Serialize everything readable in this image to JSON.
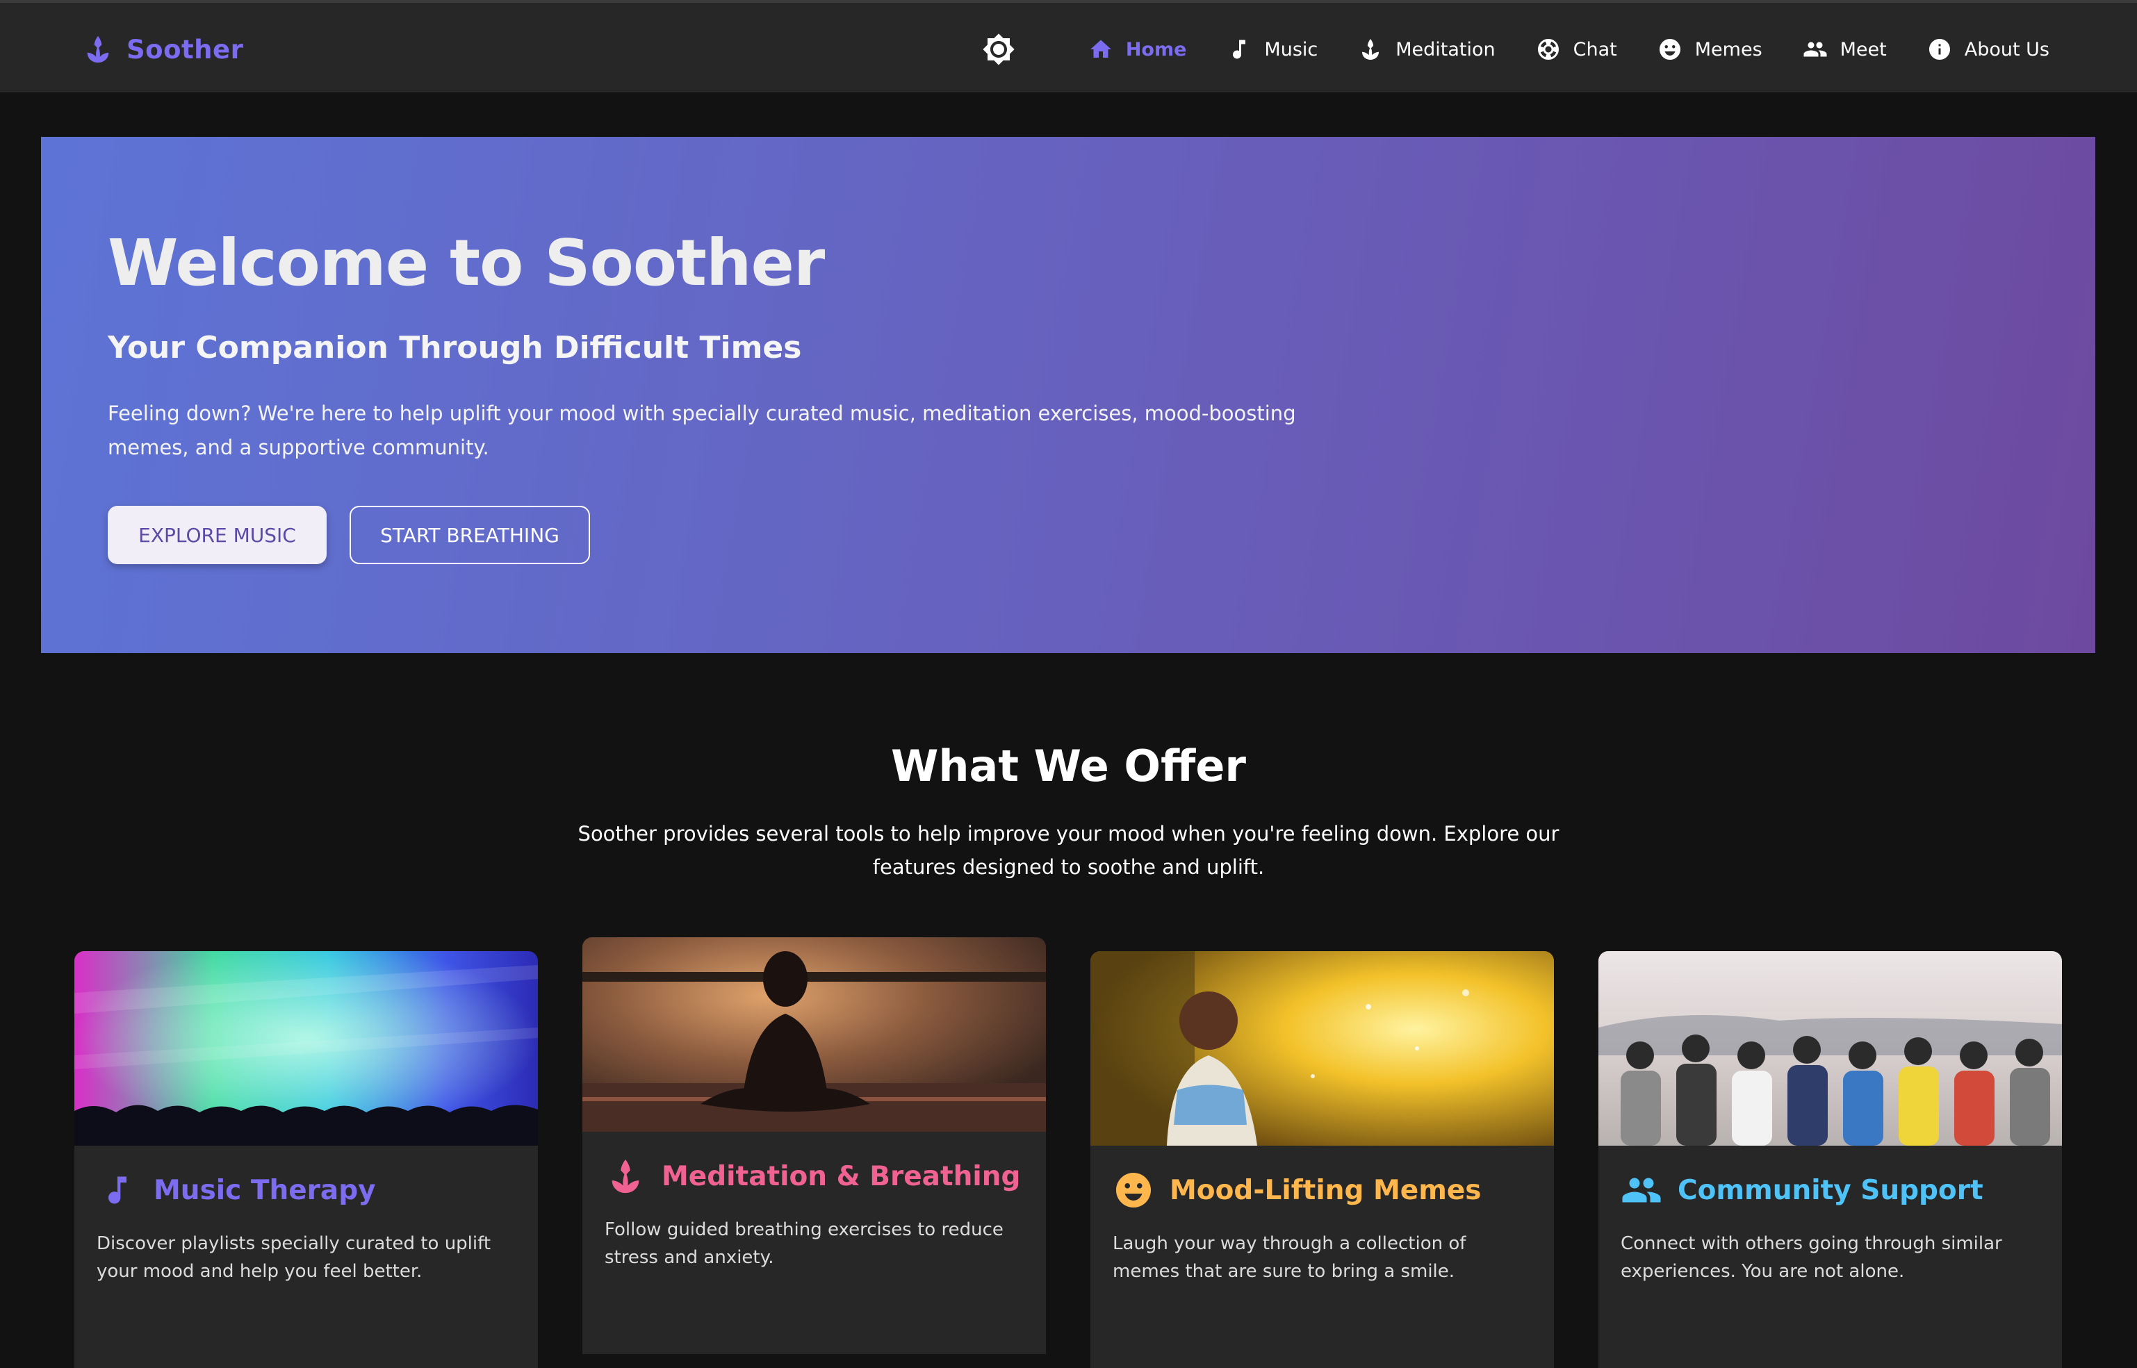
{
  "brand": {
    "name": "Soother",
    "color": "#7b6cf0"
  },
  "nav": {
    "theme_toggle_icon": "brightness-icon",
    "items": [
      {
        "label": "Home",
        "icon": "home-icon",
        "active": true
      },
      {
        "label": "Music",
        "icon": "music-note-icon",
        "active": false
      },
      {
        "label": "Meditation",
        "icon": "lotus-icon",
        "active": false
      },
      {
        "label": "Chat",
        "icon": "chat-support-icon",
        "active": false
      },
      {
        "label": "Memes",
        "icon": "smiley-icon",
        "active": false
      },
      {
        "label": "Meet",
        "icon": "people-icon",
        "active": false
      },
      {
        "label": "About Us",
        "icon": "info-icon",
        "active": false
      }
    ]
  },
  "hero": {
    "title": "Welcome to Soother",
    "subtitle": "Your Companion Through Difficult Times",
    "description": "Feeling down? We're here to help uplift your mood with specially curated music, meditation exercises, mood-boosting memes, and a supportive community.",
    "primary_button": "EXPLORE MUSIC",
    "secondary_button": "START BREATHING",
    "gradient_start": "#5d74d6",
    "gradient_end": "#6d4a9f"
  },
  "offer": {
    "title": "What We Offer",
    "description": "Soother provides several tools to help improve your mood when you're feeling down. Explore our features designed to soothe and uplift."
  },
  "cards": [
    {
      "title": "Music Therapy",
      "icon": "music-note-icon",
      "color": "#7b6cf0",
      "description": "Discover playlists specially curated to uplift your mood and help you feel better.",
      "image": "concert-crowd-image"
    },
    {
      "title": "Meditation & Breathing",
      "icon": "lotus-icon",
      "color": "#f06292",
      "description": "Follow guided breathing exercises to reduce stress and anxiety.",
      "image": "meditation-silhouette-image"
    },
    {
      "title": "Mood-Lifting Memes",
      "icon": "smiley-icon",
      "color": "#ffb74d",
      "description": "Laugh your way through a collection of memes that are sure to bring a smile.",
      "image": "child-playing-water-image"
    },
    {
      "title": "Community Support",
      "icon": "people-icon",
      "color": "#4fc3f7",
      "description": "Connect with others going through similar experiences. You are not alone.",
      "image": "friends-embracing-image"
    }
  ]
}
